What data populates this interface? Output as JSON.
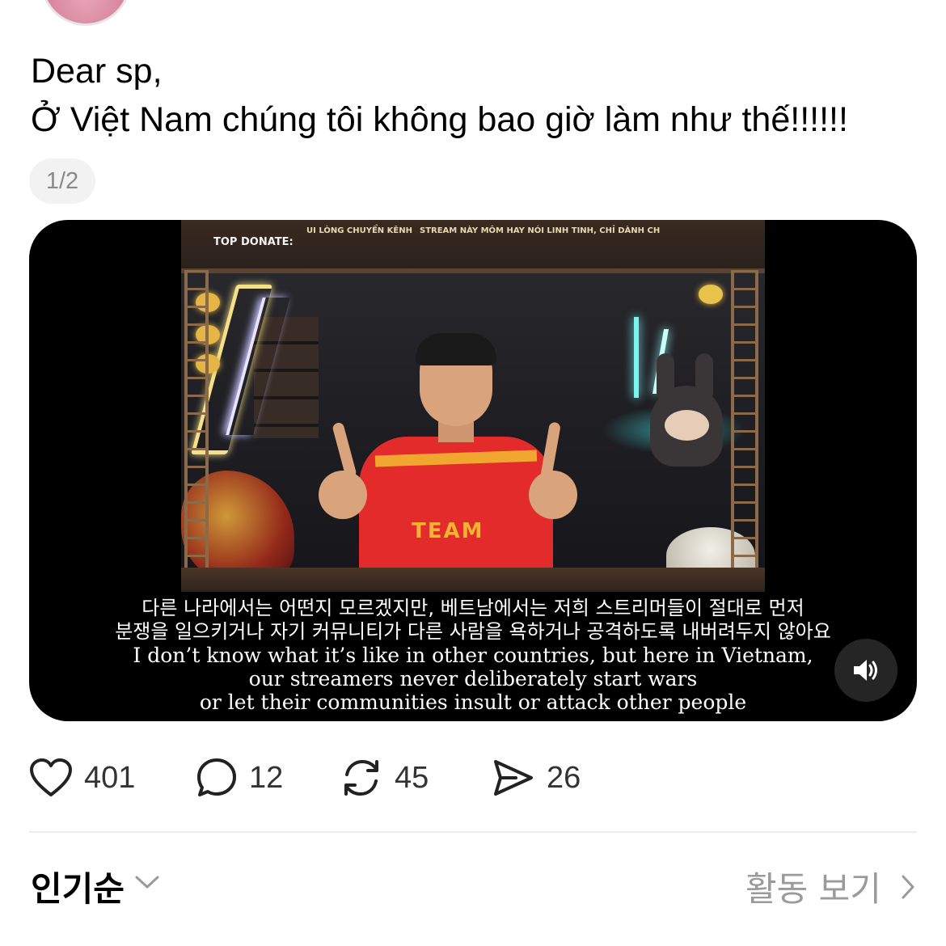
{
  "post": {
    "greeting": "Dear sp,",
    "body": "Ở Việt Nam chúng tôi không bao giờ làm như thế!!!!!!",
    "media_counter": "1/2"
  },
  "video": {
    "overlay": {
      "top_donate": "TOP DONATE:",
      "channel_text": "UI LÒNG CHUYỂN KÊNH",
      "stream_text": "STREAM NÀY MÔM HAY NÓI LINH TINH, CHỈ DÀNH CH",
      "jersey_text": "TEAM"
    },
    "subtitles": {
      "ko_line1": "다른 나라에서는 어떤지 모르겠지만, 베트남에서는 저희 스트리머들이 절대로 먼저",
      "ko_line2": "분쟁을 일으키거나 자기 커뮤니티가 다른 사람을 욕하거나 공격하도록 내버려두지 않아요",
      "en_line1": "I don’t know what it’s like in other countries, but here in Vietnam,",
      "en_line2": "our streamers never deliberately start wars",
      "en_line3": "or let their communities insult or attack other people"
    },
    "sound_icon": "speaker-icon"
  },
  "actions": {
    "likes": "401",
    "comments": "12",
    "reposts": "45",
    "shares": "26"
  },
  "replies_header": {
    "sort_label": "인기순",
    "activity_label": "활동 보기"
  },
  "colors": {
    "text_primary": "#000000",
    "text_muted": "#9a9a9a",
    "pill_bg": "#f2f2f2",
    "video_bg": "#000000"
  }
}
